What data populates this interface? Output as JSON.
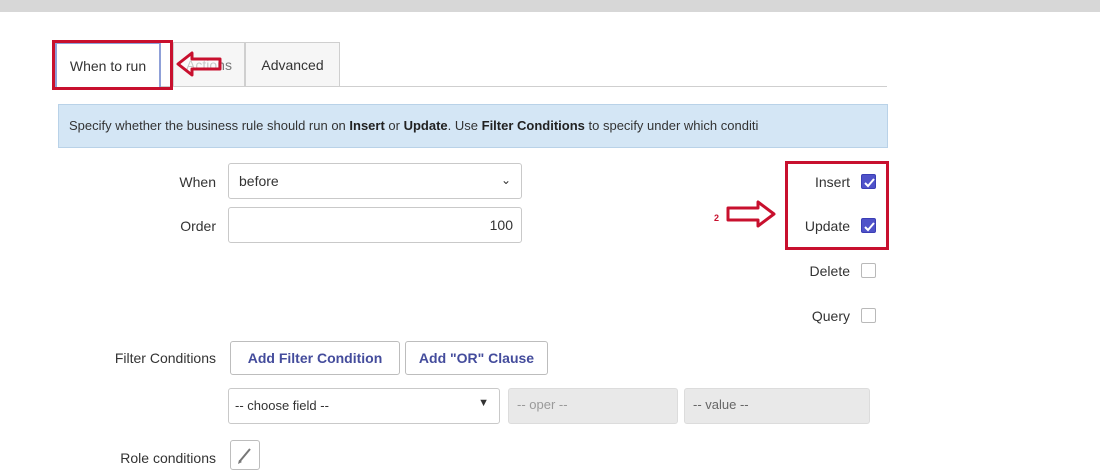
{
  "tabs": {
    "when_to_run": "When to run",
    "actions": "Actions",
    "advanced": "Advanced"
  },
  "info": {
    "t1": "Specify whether the business rule should run on ",
    "b1": "Insert",
    "t2": " or ",
    "b2": "Update",
    "t3": ". Use ",
    "b3": "Filter Conditions",
    "t4": " to specify under which conditi"
  },
  "form": {
    "when_label": "When",
    "when_value": "before",
    "order_label": "Order",
    "order_value": "100",
    "filter_label": "Filter Conditions",
    "add_filter": "Add Filter Condition",
    "add_or": "Add \"OR\" Clause",
    "choose_field": "-- choose field --",
    "oper": "-- oper --",
    "value": "-- value --",
    "role_label": "Role conditions"
  },
  "checkboxes": [
    {
      "label": "Insert",
      "checked": true
    },
    {
      "label": "Update",
      "checked": true
    },
    {
      "label": "Delete",
      "checked": false
    },
    {
      "label": "Query",
      "checked": false
    }
  ],
  "annotations": {
    "step2": "2"
  },
  "colors": {
    "annotation_red": "#c8102e",
    "checkbox_checked": "#4f52c9",
    "info_bar": "#d4e6f5",
    "button_text": "#444c9c"
  }
}
